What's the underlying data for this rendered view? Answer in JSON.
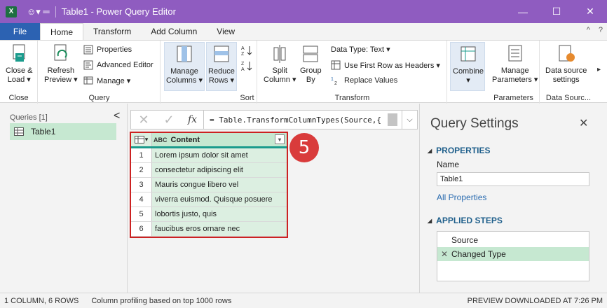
{
  "titlebar": {
    "app_icon": "X",
    "quick_access": "☺▾ ═",
    "title": "Table1 - Power Query Editor",
    "minimize": "—",
    "maximize": "☐",
    "close": "✕"
  },
  "menu": {
    "file": "File",
    "tabs": [
      "Home",
      "Transform",
      "Add Column",
      "View"
    ],
    "collapse": "^",
    "help": "?"
  },
  "ribbon": {
    "close_group": {
      "label": "Close",
      "btn": [
        "Close &",
        "Load ▾"
      ]
    },
    "query_group": {
      "label": "Query",
      "refresh": [
        "Refresh",
        "Preview ▾"
      ],
      "properties": "Properties",
      "advanced_editor": "Advanced Editor",
      "manage": "Manage ▾"
    },
    "manage_columns": [
      "Manage",
      "Columns ▾"
    ],
    "reduce_rows": [
      "Reduce",
      "Rows ▾"
    ],
    "sort_group": {
      "label": "Sort"
    },
    "transform_group": {
      "label": "Transform",
      "split": [
        "Split",
        "Column ▾"
      ],
      "group_by": [
        "Group",
        "By"
      ],
      "data_type": "Data Type: Text ▾",
      "first_row": "Use First Row as Headers ▾",
      "replace": "Replace Values"
    },
    "combine": [
      "Combine",
      "▾"
    ],
    "parameters_group": {
      "label": "Parameters",
      "btn": [
        "Manage",
        "Parameters ▾"
      ]
    },
    "datasource_group": {
      "label": "Data Sourc...",
      "btn": [
        "Data source",
        "settings"
      ]
    },
    "more": "▸"
  },
  "queries": {
    "header": "Queries [1]",
    "collapse": "<",
    "items": [
      {
        "name": "Table1"
      }
    ]
  },
  "formula": {
    "cancel": "✕",
    "commit": "✓",
    "fx": "fx",
    "text": "= Table.TransformColumnTypes(Source,{",
    "expand": "⌵"
  },
  "grid": {
    "column": {
      "type": "ABC",
      "name": "Content",
      "dropdown": "▾"
    },
    "rows": [
      {
        "n": "1",
        "v": "Lorem ipsum dolor sit amet"
      },
      {
        "n": "2",
        "v": "consectetur adipiscing elit"
      },
      {
        "n": "3",
        "v": "Mauris congue libero vel"
      },
      {
        "n": "4",
        "v": "viverra euismod. Quisque posuere"
      },
      {
        "n": "5",
        "v": "lobortis justo, quis"
      },
      {
        "n": "6",
        "v": "faucibus eros ornare nec"
      }
    ]
  },
  "badge": "5",
  "settings": {
    "title": "Query Settings",
    "close": "✕",
    "properties_header": "PROPERTIES",
    "name_label": "Name",
    "name_value": "Table1",
    "all_properties": "All Properties",
    "applied_header": "APPLIED STEPS",
    "steps": [
      {
        "name": "Source"
      },
      {
        "name": "Changed Type"
      }
    ]
  },
  "status": {
    "columns": "1 COLUMN, 6 ROWS",
    "profiling": "Column profiling based on top 1000 rows",
    "preview": "PREVIEW DOWNLOADED AT 7:26 PM"
  }
}
